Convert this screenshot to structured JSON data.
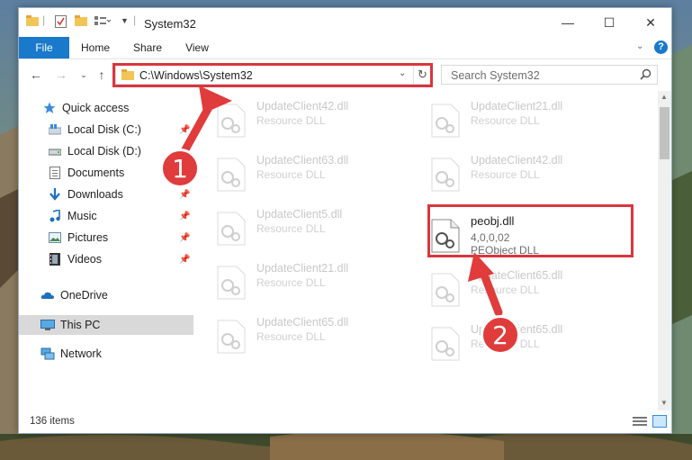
{
  "window": {
    "title": "System32",
    "controls": {
      "minimize": "—",
      "maximize": "☐",
      "close": "✕"
    }
  },
  "ribbon": {
    "tabs": [
      "File",
      "Home",
      "Share",
      "View"
    ]
  },
  "navigation": {
    "address": "C:\\Windows\\System32",
    "search_placeholder": "Search System32"
  },
  "sidebar": {
    "items": [
      {
        "label": "Quick access",
        "icon": "star-icon",
        "pinned": false
      },
      {
        "label": "Local Disk (C:)",
        "icon": "drive-icon",
        "pinned": true
      },
      {
        "label": "Local Disk (D:)",
        "icon": "drive-icon",
        "pinned": false
      },
      {
        "label": "Documents",
        "icon": "documents-icon",
        "pinned": true
      },
      {
        "label": "Downloads",
        "icon": "download-icon",
        "pinned": true
      },
      {
        "label": "Music",
        "icon": "music-icon",
        "pinned": true
      },
      {
        "label": "Pictures",
        "icon": "pictures-icon",
        "pinned": true
      },
      {
        "label": "Videos",
        "icon": "videos-icon",
        "pinned": true
      },
      {
        "label": "OneDrive",
        "icon": "onedrive-icon",
        "pinned": false
      },
      {
        "label": "This PC",
        "icon": "pc-icon",
        "pinned": false,
        "selected": true
      },
      {
        "label": "Network",
        "icon": "network-icon",
        "pinned": false
      }
    ]
  },
  "files": {
    "left_column": [
      {
        "name": "UpdateClient42.dll",
        "type": "Resource DLL"
      },
      {
        "name": "UpdateClient63.dll",
        "type": "Resource DLL"
      },
      {
        "name": "UpdateClient5.dll",
        "type": "Resource DLL"
      },
      {
        "name": "UpdateClient21.dll",
        "type": "Resource DLL"
      },
      {
        "name": "UpdateClient65.dll",
        "type": "Resource DLL"
      }
    ],
    "right_column": [
      {
        "name": "UpdateClient21.dll",
        "type": "Resource DLL"
      },
      {
        "name": "UpdateClient42.dll",
        "type": "Resource DLL"
      },
      {
        "name": "peobj.dll",
        "version": "4,0,0,02",
        "type": "PEObject DLL",
        "focus": true
      },
      {
        "name": "UpdateClient65.dll",
        "type": "Resource DLL"
      },
      {
        "name": "UpdateClient65.dll",
        "type": "Resource DLL"
      }
    ]
  },
  "status": {
    "item_count": "136 items"
  },
  "annotations": {
    "badge1": "1",
    "badge2": "2"
  },
  "colors": {
    "accent": "#1979ca",
    "highlight": "#d9363e",
    "selected": "#d9d9d9"
  }
}
